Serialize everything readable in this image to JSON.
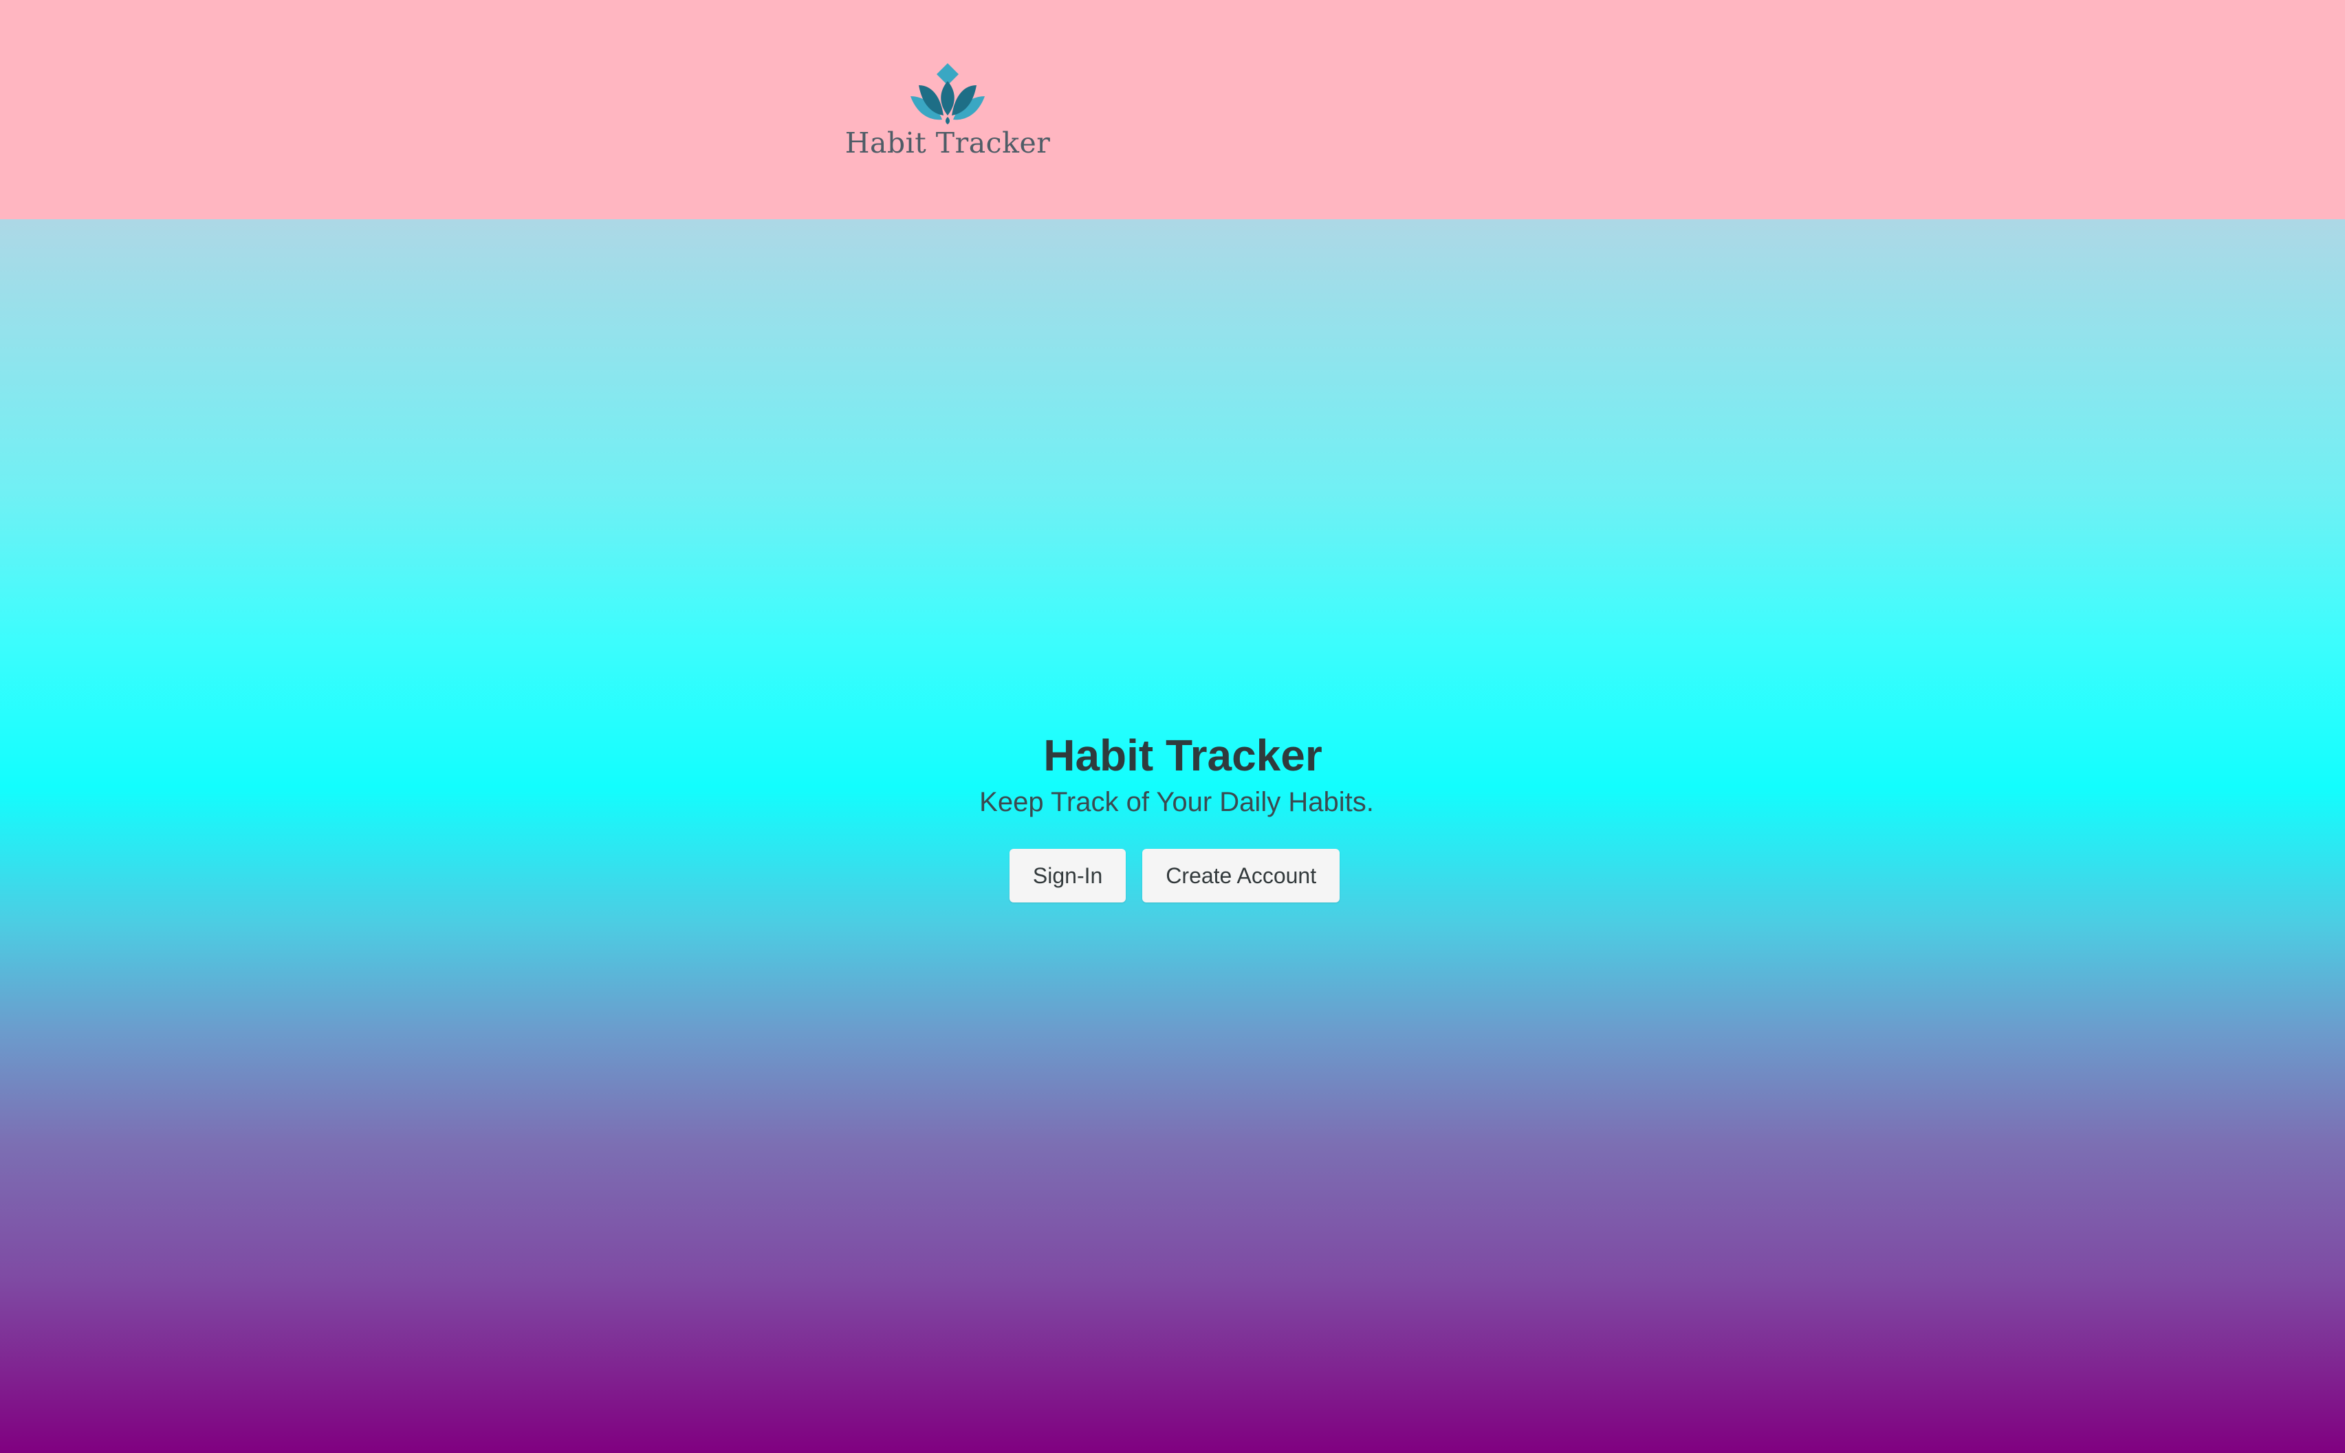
{
  "header": {
    "logo_text": "Habit Tracker",
    "logo_icon": "lotus-icon",
    "background": "#ffb6c1"
  },
  "hero": {
    "title": "Habit Tracker",
    "subtitle": "Keep Track of Your Daily Habits.",
    "gradient": [
      "#add8e6",
      "#00ffff",
      "#800080"
    ]
  },
  "actions": {
    "sign_in_label": "Sign-In",
    "create_account_label": "Create Account"
  },
  "colors": {
    "lotus_light": "#3aa7c3",
    "lotus_dark": "#1e6e86",
    "text_dark": "#2f3b3d",
    "button_bg": "#f5f5f5"
  }
}
